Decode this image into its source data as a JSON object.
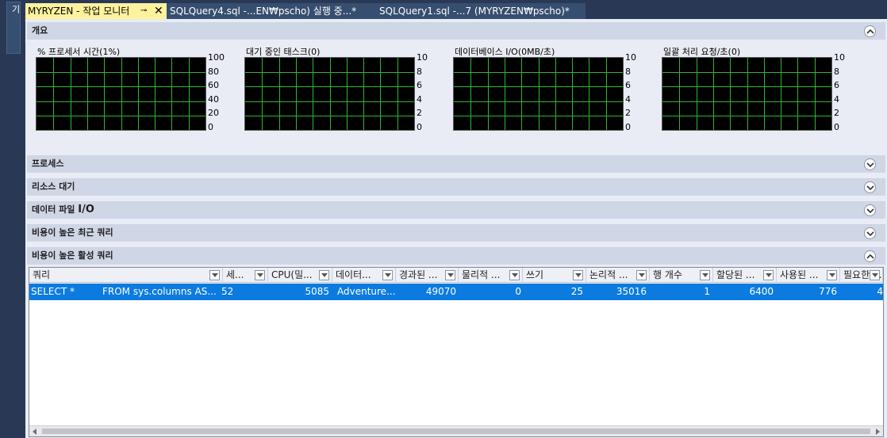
{
  "sidebar": {
    "vertical_tab": "개체 탐색기"
  },
  "tabs": [
    {
      "label": "MYRYZEN - 작업 모니터",
      "pin": "⊸",
      "close": "✕",
      "active": true
    },
    {
      "label": "SQLQuery4.sql -...EN₩pscho) 실행 중...*",
      "active": false
    },
    {
      "label": "SQLQuery1.sql -...7 (MYRYZEN₩pscho)*",
      "active": false
    }
  ],
  "sections": {
    "overview": "개요",
    "processes": "프로세스",
    "resource_waits": "리소스 대기",
    "data_file_io_prefix": "데이터 파일",
    "data_file_io_suffix": "I/O",
    "recent_expensive": "비용이 높은 최근 쿼리",
    "active_expensive": "비용이 높은 활성 쿼리"
  },
  "charts": [
    {
      "title": "% 프로세서 시간(1%)",
      "y_ticks": [
        "100",
        "80",
        "60",
        "40",
        "20",
        "0"
      ]
    },
    {
      "title": "대기 중인 태스크(0)",
      "y_ticks": [
        "10",
        "8",
        "6",
        "4",
        "2",
        "0"
      ]
    },
    {
      "title": "데이터베이스 I/O(0MB/초)",
      "y_ticks": [
        "10",
        "8",
        "6",
        "4",
        "2",
        "0"
      ]
    },
    {
      "title": "일괄 처리 요청/초(0)",
      "y_ticks": [
        "10",
        "8",
        "6",
        "4",
        "2",
        "0"
      ]
    }
  ],
  "grid": {
    "columns": [
      "쿼리",
      "세...",
      "CPU(밀...",
      "데이터...",
      "경과된 ...",
      "물리적 ...",
      "쓰기",
      "논리적 ...",
      "행 개수",
      "할당된 ...",
      "사용된 ...",
      "필요한 ..."
    ],
    "rows": [
      [
        "SELECT *",
        "FROM sys.columns AS...",
        "52",
        "5085",
        "Adventure...",
        "49070",
        "0",
        "25",
        "35016",
        "1",
        "6400",
        "776",
        "4"
      ]
    ]
  },
  "colors": {
    "active_tab": "#fff29d",
    "selected_row": "#0c7be0",
    "chart_grid": "#2db82d",
    "chart_bg": "#000000"
  }
}
